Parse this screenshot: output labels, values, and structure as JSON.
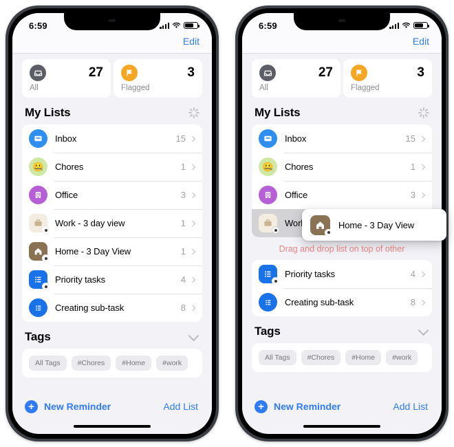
{
  "colors": {
    "accent": "#2f7bf6",
    "warning": "#ef8585",
    "flag": "#f5a622",
    "screen_bg": "#f2f2f7",
    "card_bg": "#ffffff"
  },
  "status_bar": {
    "time": "6:59",
    "cellular_icon": "cellular-bars-icon",
    "wifi_icon": "wifi-icon",
    "battery_icon": "battery-icon"
  },
  "navbar": {
    "edit_label": "Edit"
  },
  "smart_lists": [
    {
      "key": "all",
      "icon": "tray-icon",
      "count": "27",
      "label": "All",
      "color": "#5b5e66"
    },
    {
      "key": "flagged",
      "icon": "flag-icon",
      "count": "3",
      "label": "Flagged",
      "color": "#f5a622"
    }
  ],
  "my_lists": {
    "title": "My Lists",
    "spinner_icon": "activity-spinner-icon",
    "items": [
      {
        "name": "Inbox",
        "count": "15",
        "icon": "inbox-tray-icon",
        "shape": "circle",
        "color": "#2f8ff0",
        "badge": false
      },
      {
        "name": "Chores",
        "count": "1",
        "icon": "smiley-face-icon",
        "shape": "circle",
        "color": "#c8e6a0",
        "badge": false
      },
      {
        "name": "Office",
        "count": "3",
        "icon": "building-icon",
        "shape": "circle",
        "color": "#b65fd6",
        "badge": false
      },
      {
        "name": "Work - 3 day view",
        "count": "1",
        "icon": "briefcase-icon",
        "shape": "square",
        "color": "#f3ece0",
        "badge": true
      },
      {
        "name": "Home - 3 Day View",
        "count": "1",
        "icon": "house-icon",
        "shape": "square",
        "color": "#8a7355",
        "badge": true
      },
      {
        "name": "Priority tasks",
        "count": "4",
        "icon": "list-bullet-icon",
        "shape": "square",
        "color": "#1a72e8",
        "badge": true
      },
      {
        "name": "Creating sub-task",
        "count": "8",
        "icon": "list-bullet-icon",
        "shape": "circle",
        "color": "#1a72e8",
        "badge": false
      }
    ]
  },
  "tags": {
    "title": "Tags",
    "collapse_icon": "chevron-down-icon",
    "items": [
      "All Tags",
      "#Chores",
      "#Home",
      "#work"
    ]
  },
  "bottom_bar": {
    "new_reminder_label": "New Reminder",
    "add_list_label": "Add List",
    "plus_icon": "plus-circle-icon"
  },
  "drag_state": {
    "hint_text": "Drag and drop list on top of other",
    "dragged_item": {
      "name": "Home - 3 Day View",
      "icon": "house-icon",
      "color": "#8a7355"
    },
    "drop_target_name": "Work - 3 day view"
  }
}
